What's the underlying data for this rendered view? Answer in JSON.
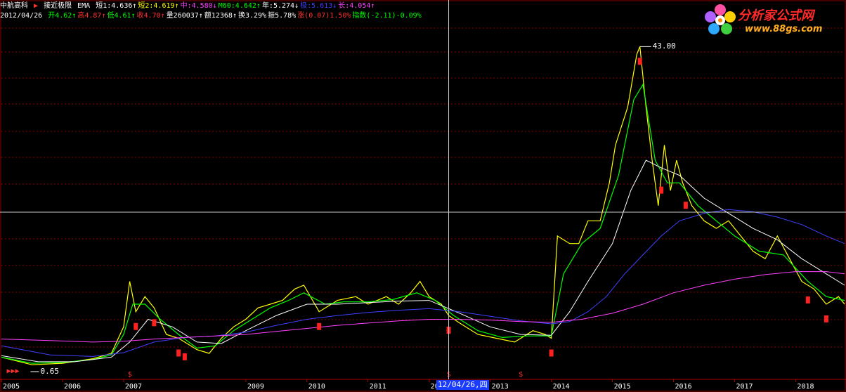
{
  "header": {
    "stock_name": "中航高科",
    "indicator": "接近极限",
    "ma_type": "EMA",
    "params": [
      {
        "label": "短1:4.636↑",
        "color": "#ffffff"
      },
      {
        "label": "短2:4.619↑",
        "color": "#ffff00"
      },
      {
        "label": "中:4.580↓",
        "color": "#ff40ff"
      },
      {
        "label": "M60:4.642↑",
        "color": "#00ff00"
      },
      {
        "label": "年:5.274↓",
        "color": "#ffffff"
      },
      {
        "label": "极:5.613↓",
        "color": "#4040ff"
      },
      {
        "label": "长:4.054↑",
        "color": "#ff40ff"
      }
    ],
    "date": "2012/04/26",
    "quote": [
      {
        "label": "开4.62↑",
        "color": "#00ff00"
      },
      {
        "label": "高4.87↑",
        "color": "#ff3030"
      },
      {
        "label": "低4.61↑",
        "color": "#00ff00"
      },
      {
        "label": "收4.70↑",
        "color": "#ff3030"
      },
      {
        "label": "量260037↑",
        "color": "#ffffff"
      },
      {
        "label": "额12368↑",
        "color": "#ffffff"
      },
      {
        "label": "换3.29%",
        "color": "#ffffff"
      },
      {
        "label": "振5.78%",
        "color": "#ffffff"
      },
      {
        "label": "涨(0.07)1.50%",
        "color": "#ff3030"
      },
      {
        "label": "指数(-2.11)-0.09%",
        "color": "#00ff00"
      }
    ]
  },
  "logo": {
    "name": "分析家公式网",
    "url": "www.88gs.com"
  },
  "crosshair": {
    "date_label": "12/04/26,四"
  },
  "chart_data": {
    "type": "line",
    "x_ticks": [
      "2005",
      "2006",
      "2007",
      "2009",
      "2010",
      "2011",
      "2012",
      "2013",
      "2014",
      "2015",
      "2016",
      "2017",
      "2018"
    ],
    "x_tick_years": [
      2005.0,
      2006.0,
      2007.0,
      2009.0,
      2010.0,
      2011.0,
      2012.0,
      2013.0,
      2014.0,
      2015.0,
      2016.0,
      2017.0,
      2018.0
    ],
    "peak": {
      "value": "43.00",
      "year": 2015.45
    },
    "low": {
      "value": "0.65",
      "year": 2005.5
    },
    "ylim": [
      0,
      46
    ],
    "xlim": [
      2005.0,
      2018.8
    ],
    "series": [
      {
        "color": "#ffff00",
        "points": [
          [
            2005.0,
            2.0
          ],
          [
            2005.5,
            1.0
          ],
          [
            2006.0,
            1.2
          ],
          [
            2006.5,
            1.8
          ],
          [
            2006.8,
            2.5
          ],
          [
            2007.0,
            6
          ],
          [
            2007.1,
            12
          ],
          [
            2007.2,
            8
          ],
          [
            2007.35,
            10
          ],
          [
            2007.5,
            8.5
          ],
          [
            2007.7,
            5
          ],
          [
            2007.9,
            4.5
          ],
          [
            2008.2,
            3
          ],
          [
            2008.4,
            2.5
          ],
          [
            2008.6,
            4.5
          ],
          [
            2008.8,
            6
          ],
          [
            2009.0,
            7
          ],
          [
            2009.2,
            8.5
          ],
          [
            2009.4,
            9
          ],
          [
            2009.6,
            9.5
          ],
          [
            2009.8,
            11
          ],
          [
            2009.95,
            11.5
          ],
          [
            2010.2,
            8
          ],
          [
            2010.5,
            9.5
          ],
          [
            2010.8,
            10
          ],
          [
            2011.0,
            9
          ],
          [
            2011.3,
            10
          ],
          [
            2011.5,
            9
          ],
          [
            2011.7,
            10.5
          ],
          [
            2011.85,
            12
          ],
          [
            2012.0,
            10
          ],
          [
            2012.2,
            9
          ],
          [
            2012.32,
            7.5
          ],
          [
            2012.5,
            6.5
          ],
          [
            2012.8,
            5
          ],
          [
            2013.1,
            4.5
          ],
          [
            2013.4,
            4
          ],
          [
            2013.7,
            5.5
          ],
          [
            2013.9,
            5
          ],
          [
            2014.0,
            4.5
          ],
          [
            2014.1,
            18
          ],
          [
            2014.3,
            17
          ],
          [
            2014.45,
            17
          ],
          [
            2014.6,
            20
          ],
          [
            2014.8,
            20
          ],
          [
            2014.95,
            25
          ],
          [
            2015.05,
            30
          ],
          [
            2015.25,
            35
          ],
          [
            2015.4,
            42
          ],
          [
            2015.45,
            43
          ],
          [
            2015.55,
            35
          ],
          [
            2015.65,
            28
          ],
          [
            2015.75,
            22
          ],
          [
            2015.85,
            30
          ],
          [
            2015.95,
            24
          ],
          [
            2016.05,
            28
          ],
          [
            2016.15,
            25
          ],
          [
            2016.3,
            22
          ],
          [
            2016.5,
            20
          ],
          [
            2016.7,
            19
          ],
          [
            2016.9,
            20
          ],
          [
            2017.1,
            18
          ],
          [
            2017.3,
            16
          ],
          [
            2017.5,
            15
          ],
          [
            2017.7,
            18
          ],
          [
            2017.9,
            15
          ],
          [
            2018.1,
            12
          ],
          [
            2018.3,
            11
          ],
          [
            2018.5,
            9
          ],
          [
            2018.7,
            10
          ],
          [
            2018.8,
            9
          ]
        ]
      },
      {
        "color": "#00ff00",
        "points": [
          [
            2005.0,
            2.0
          ],
          [
            2005.5,
            1.2
          ],
          [
            2006.0,
            1.3
          ],
          [
            2006.5,
            1.7
          ],
          [
            2006.8,
            2.3
          ],
          [
            2007.0,
            5
          ],
          [
            2007.15,
            9
          ],
          [
            2007.35,
            9
          ],
          [
            2007.6,
            7
          ],
          [
            2007.9,
            5
          ],
          [
            2008.2,
            3.2
          ],
          [
            2008.5,
            3.5
          ],
          [
            2008.8,
            5.5
          ],
          [
            2009.1,
            7
          ],
          [
            2009.4,
            8.5
          ],
          [
            2009.7,
            9.5
          ],
          [
            2009.95,
            10.5
          ],
          [
            2010.3,
            9
          ],
          [
            2010.6,
            9.3
          ],
          [
            2011.0,
            9.3
          ],
          [
            2011.4,
            9.6
          ],
          [
            2011.8,
            10.5
          ],
          [
            2012.1,
            9.5
          ],
          [
            2012.4,
            7.5
          ],
          [
            2012.8,
            5.5
          ],
          [
            2013.2,
            4.6
          ],
          [
            2013.6,
            4.8
          ],
          [
            2014.0,
            4.8
          ],
          [
            2014.2,
            13
          ],
          [
            2014.5,
            17
          ],
          [
            2014.8,
            19
          ],
          [
            2015.1,
            26
          ],
          [
            2015.35,
            36
          ],
          [
            2015.5,
            38
          ],
          [
            2015.7,
            28
          ],
          [
            2015.9,
            25
          ],
          [
            2016.1,
            25
          ],
          [
            2016.4,
            22
          ],
          [
            2016.7,
            20
          ],
          [
            2017.0,
            18
          ],
          [
            2017.4,
            16
          ],
          [
            2017.8,
            15.5
          ],
          [
            2018.2,
            12
          ],
          [
            2018.5,
            10
          ],
          [
            2018.8,
            9.5
          ]
        ]
      },
      {
        "color": "#ffffff",
        "points": [
          [
            2005.0,
            2.2
          ],
          [
            2005.6,
            1.4
          ],
          [
            2006.2,
            1.4
          ],
          [
            2006.8,
            2.0
          ],
          [
            2007.1,
            4
          ],
          [
            2007.4,
            7
          ],
          [
            2007.8,
            6
          ],
          [
            2008.2,
            4
          ],
          [
            2008.6,
            3.8
          ],
          [
            2009.0,
            5.5
          ],
          [
            2009.5,
            7.5
          ],
          [
            2010.0,
            9
          ],
          [
            2010.5,
            9
          ],
          [
            2011.0,
            9.2
          ],
          [
            2011.5,
            9.4
          ],
          [
            2012.0,
            9.5
          ],
          [
            2012.5,
            7.8
          ],
          [
            2013.0,
            6
          ],
          [
            2013.5,
            5
          ],
          [
            2014.0,
            4.9
          ],
          [
            2014.3,
            8
          ],
          [
            2014.6,
            12
          ],
          [
            2015.0,
            17
          ],
          [
            2015.3,
            24
          ],
          [
            2015.55,
            28
          ],
          [
            2015.8,
            27
          ],
          [
            2016.1,
            26
          ],
          [
            2016.5,
            23
          ],
          [
            2016.9,
            21
          ],
          [
            2017.3,
            19
          ],
          [
            2017.7,
            17.5
          ],
          [
            2018.1,
            15
          ],
          [
            2018.5,
            13
          ],
          [
            2018.8,
            11.5
          ]
        ]
      },
      {
        "color": "#4040ff",
        "points": [
          [
            2005.0,
            3.5
          ],
          [
            2005.8,
            2.3
          ],
          [
            2006.5,
            2.1
          ],
          [
            2007.0,
            2.6
          ],
          [
            2007.5,
            4
          ],
          [
            2008.0,
            4.6
          ],
          [
            2008.5,
            4.8
          ],
          [
            2009.0,
            5.3
          ],
          [
            2009.5,
            6.2
          ],
          [
            2010.0,
            7.0
          ],
          [
            2010.5,
            7.5
          ],
          [
            2011.0,
            7.9
          ],
          [
            2011.5,
            8.2
          ],
          [
            2012.0,
            8.4
          ],
          [
            2012.5,
            8.0
          ],
          [
            2013.0,
            7.4
          ],
          [
            2013.5,
            6.8
          ],
          [
            2014.0,
            6.4
          ],
          [
            2014.3,
            6.7
          ],
          [
            2014.6,
            8.0
          ],
          [
            2014.9,
            10
          ],
          [
            2015.2,
            13
          ],
          [
            2015.5,
            15.5
          ],
          [
            2015.8,
            18
          ],
          [
            2016.1,
            20
          ],
          [
            2016.5,
            21
          ],
          [
            2016.9,
            21.5
          ],
          [
            2017.3,
            21.2
          ],
          [
            2017.7,
            20.5
          ],
          [
            2018.1,
            19.5
          ],
          [
            2018.5,
            18
          ],
          [
            2018.8,
            17
          ]
        ]
      },
      {
        "color": "#ff40ff",
        "points": [
          [
            2005.0,
            4.4
          ],
          [
            2005.8,
            4.2
          ],
          [
            2006.5,
            4.0
          ],
          [
            2007.0,
            4.1
          ],
          [
            2007.5,
            4.4
          ],
          [
            2008.0,
            4.6
          ],
          [
            2008.5,
            4.8
          ],
          [
            2009.0,
            5.0
          ],
          [
            2009.5,
            5.4
          ],
          [
            2010.0,
            5.8
          ],
          [
            2010.5,
            6.2
          ],
          [
            2011.0,
            6.5
          ],
          [
            2011.5,
            6.8
          ],
          [
            2012.0,
            7.0
          ],
          [
            2012.5,
            7.0
          ],
          [
            2013.0,
            6.9
          ],
          [
            2013.5,
            6.7
          ],
          [
            2014.0,
            6.6
          ],
          [
            2014.5,
            7.0
          ],
          [
            2015.0,
            7.8
          ],
          [
            2015.5,
            9.0
          ],
          [
            2016.0,
            10.5
          ],
          [
            2016.5,
            11.5
          ],
          [
            2017.0,
            12.3
          ],
          [
            2017.5,
            12.9
          ],
          [
            2018.0,
            13.3
          ],
          [
            2018.5,
            13.3
          ],
          [
            2018.8,
            13.0
          ]
        ]
      }
    ],
    "sell_markers": [
      2007.2,
      2007.5,
      2007.9,
      2008.0,
      2010.2,
      2012.32,
      2014.0,
      2015.45,
      2015.8,
      2016.2,
      2018.2,
      2018.5
    ],
    "buy_markers": [
      2007.1,
      2012.32,
      2013.5
    ]
  }
}
